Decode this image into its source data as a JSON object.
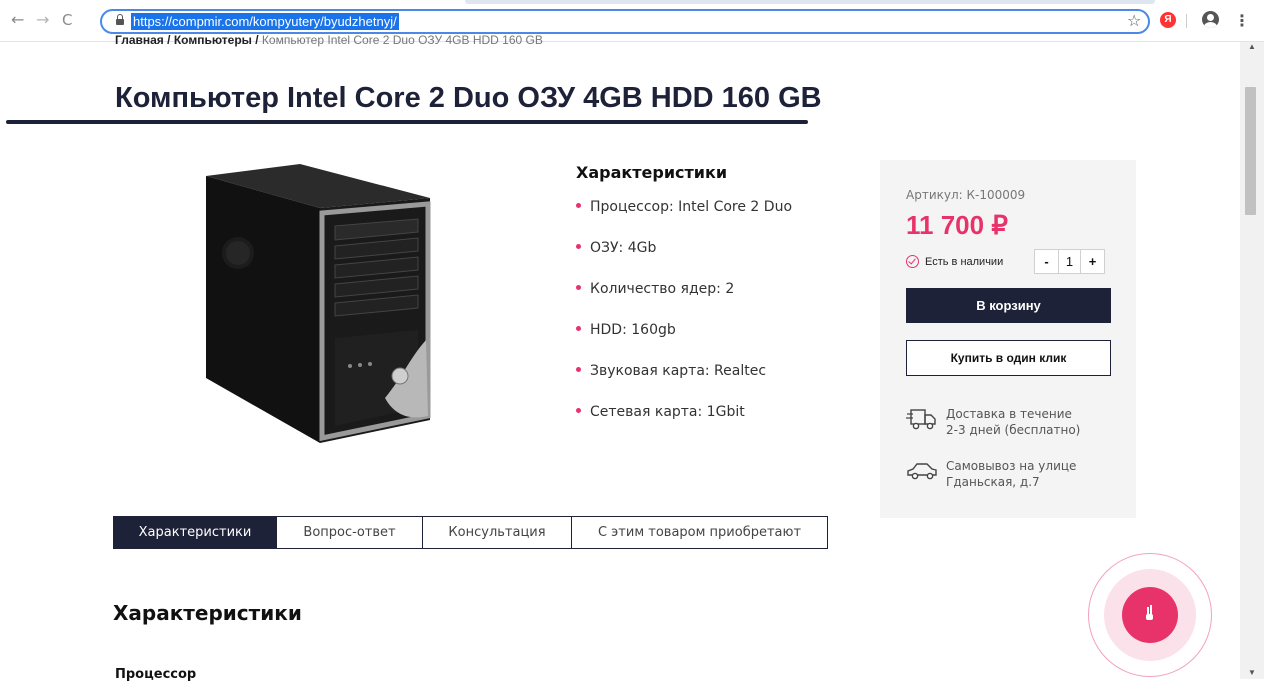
{
  "browser": {
    "url": "https://compmir.com/kompyutery/byudzhetnyj/"
  },
  "breadcrumb": {
    "home": "Главная /",
    "category": "Компьютеры /",
    "current": "Компьютер Intel Core 2 Duo ОЗУ 4GB HDD 160 GB"
  },
  "product": {
    "title": "Компьютер Intel Core 2 Duo ОЗУ 4GB HDD 160 GB"
  },
  "specs": {
    "heading": "Характеристики",
    "items": [
      "Процессор: Intel Core 2 Duo",
      "ОЗУ: 4Gb",
      "Количество ядер: 2",
      "HDD: 160gb",
      "Звуковая карта: Realtec",
      "Сетевая карта: 1Gbit"
    ]
  },
  "buy_box": {
    "sku": "Артикул: К-100009",
    "price": "11 700 ₽",
    "stock": "Есть в наличии",
    "qty_minus": "-",
    "qty_value": "1",
    "qty_plus": "+",
    "add_to_cart": "В корзину",
    "one_click": "Купить в один клик",
    "delivery_line1": "Доставка в течение",
    "delivery_line2": "2-3 дней (бесплатно)",
    "pickup_line1": "Самовывоз на улице",
    "pickup_line2": "Гданьская, д.7",
    "accent_color": "#e8336a",
    "dark_color": "#1e2238"
  },
  "tabs": [
    {
      "label": "Характеристики",
      "active": true
    },
    {
      "label": "Вопрос-ответ",
      "active": false
    },
    {
      "label": "Консультация",
      "active": false
    },
    {
      "label": "С этим товаром приобретают",
      "active": false
    }
  ],
  "section": {
    "heading": "Характеристики",
    "subheading": "Процессор"
  }
}
